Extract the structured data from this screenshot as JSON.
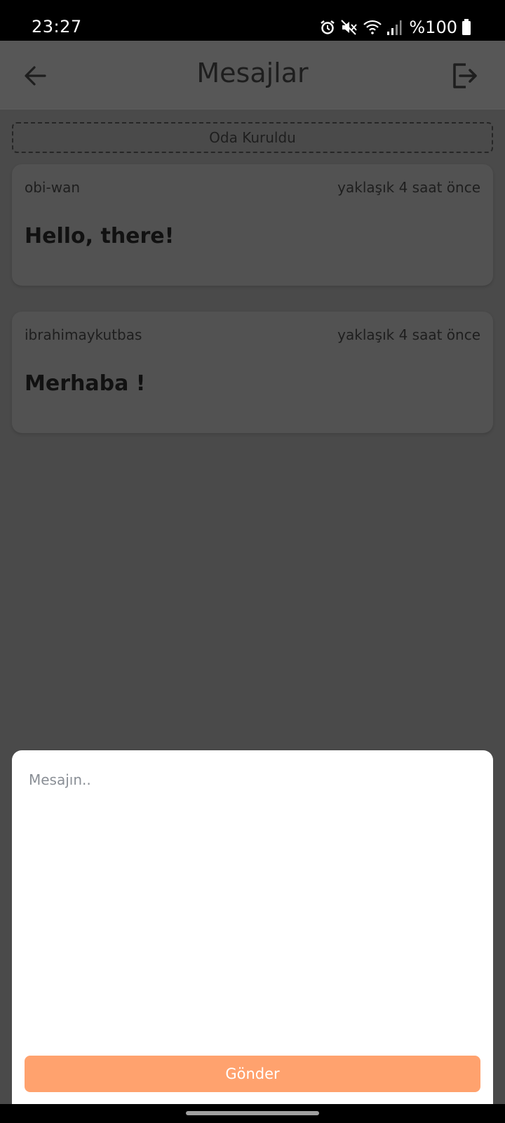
{
  "status_bar": {
    "time": "23:27",
    "battery": "%100",
    "icons": [
      "alarm-icon",
      "mute-icon",
      "wifi-icon",
      "signal-icon",
      "battery-icon"
    ]
  },
  "header": {
    "title": "Mesajlar",
    "back_icon": "arrow-left-icon",
    "exit_icon": "logout-icon"
  },
  "room_banner": "Oda Kuruldu",
  "messages": [
    {
      "user": "obi-wan",
      "time": "yaklaşık 4 saat önce",
      "text": "Hello, there!"
    },
    {
      "user": "ibrahimaykutbas",
      "time": "yaklaşık 4 saat önce",
      "text": "Merhaba !"
    }
  ],
  "composer": {
    "placeholder": "Mesajın..",
    "value": "",
    "send_label": "Gönder"
  },
  "colors": {
    "accent": "#ffa26e",
    "overlay_background": "#4a4a4a",
    "sheet_background": "#ffffff"
  }
}
